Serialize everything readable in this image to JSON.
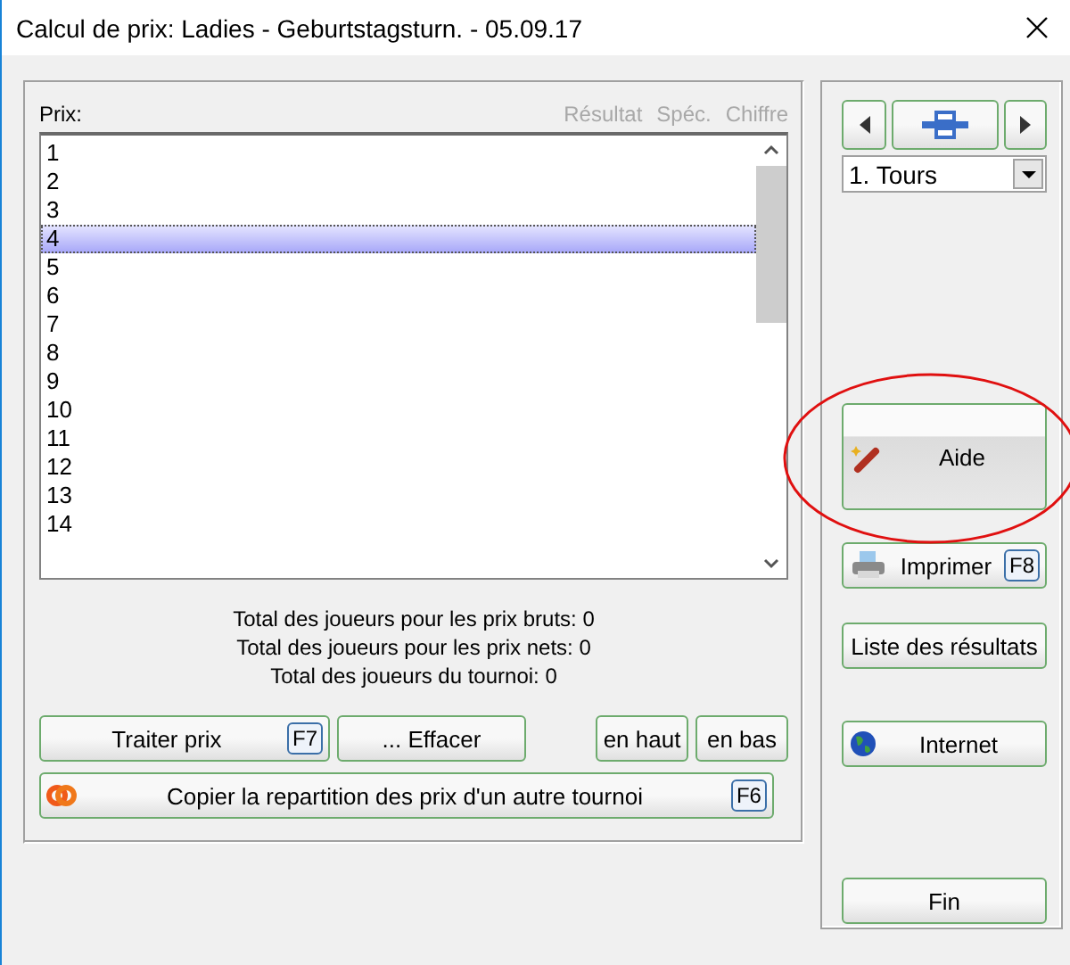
{
  "window": {
    "title": "Calcul de prix: Ladies - Geburtstagsturn. - 05.09.17"
  },
  "prizes": {
    "label": "Prix:",
    "columns": [
      {
        "label": "Résultat",
        "disabled": true
      },
      {
        "label": "Spéc.",
        "disabled": true
      },
      {
        "label": "Chiffre",
        "disabled": true
      }
    ],
    "rows": [
      {
        "label": "1",
        "selected": false
      },
      {
        "label": "2",
        "selected": false
      },
      {
        "label": "3",
        "selected": false
      },
      {
        "label": "4",
        "selected": true
      },
      {
        "label": "5",
        "selected": false
      },
      {
        "label": "6",
        "selected": false
      },
      {
        "label": "7",
        "selected": false
      },
      {
        "label": "8",
        "selected": false
      },
      {
        "label": "9",
        "selected": false
      },
      {
        "label": "10",
        "selected": false
      },
      {
        "label": "11",
        "selected": false
      },
      {
        "label": "12",
        "selected": false
      },
      {
        "label": "13",
        "selected": false
      },
      {
        "label": "14",
        "selected": false
      }
    ]
  },
  "totals": [
    "Total des joueurs pour les prix bruts: 0",
    "Total des joueurs pour les prix nets: 0",
    "Total des joueurs du tournoi: 0"
  ],
  "actions": [
    {
      "label": "Traiter prix",
      "key": "F7"
    },
    {
      "label": "... Effacer"
    }
  ],
  "move": [
    "en haut",
    "en bas"
  ],
  "copy": {
    "label": "Copier la repartition des prix d'un autre tournoi",
    "key": "F6"
  },
  "round": {
    "value": "1. Tours"
  },
  "side_buttons": [
    {
      "kind": "help",
      "label": "Aide",
      "highlighted": true
    },
    {
      "kind": "print",
      "label": "Imprimer",
      "key": "F8"
    },
    {
      "kind": "plain",
      "label": "Liste des résultats"
    },
    {
      "kind": "internet",
      "label": "Internet"
    },
    {
      "kind": "close",
      "label": "Fin"
    }
  ]
}
